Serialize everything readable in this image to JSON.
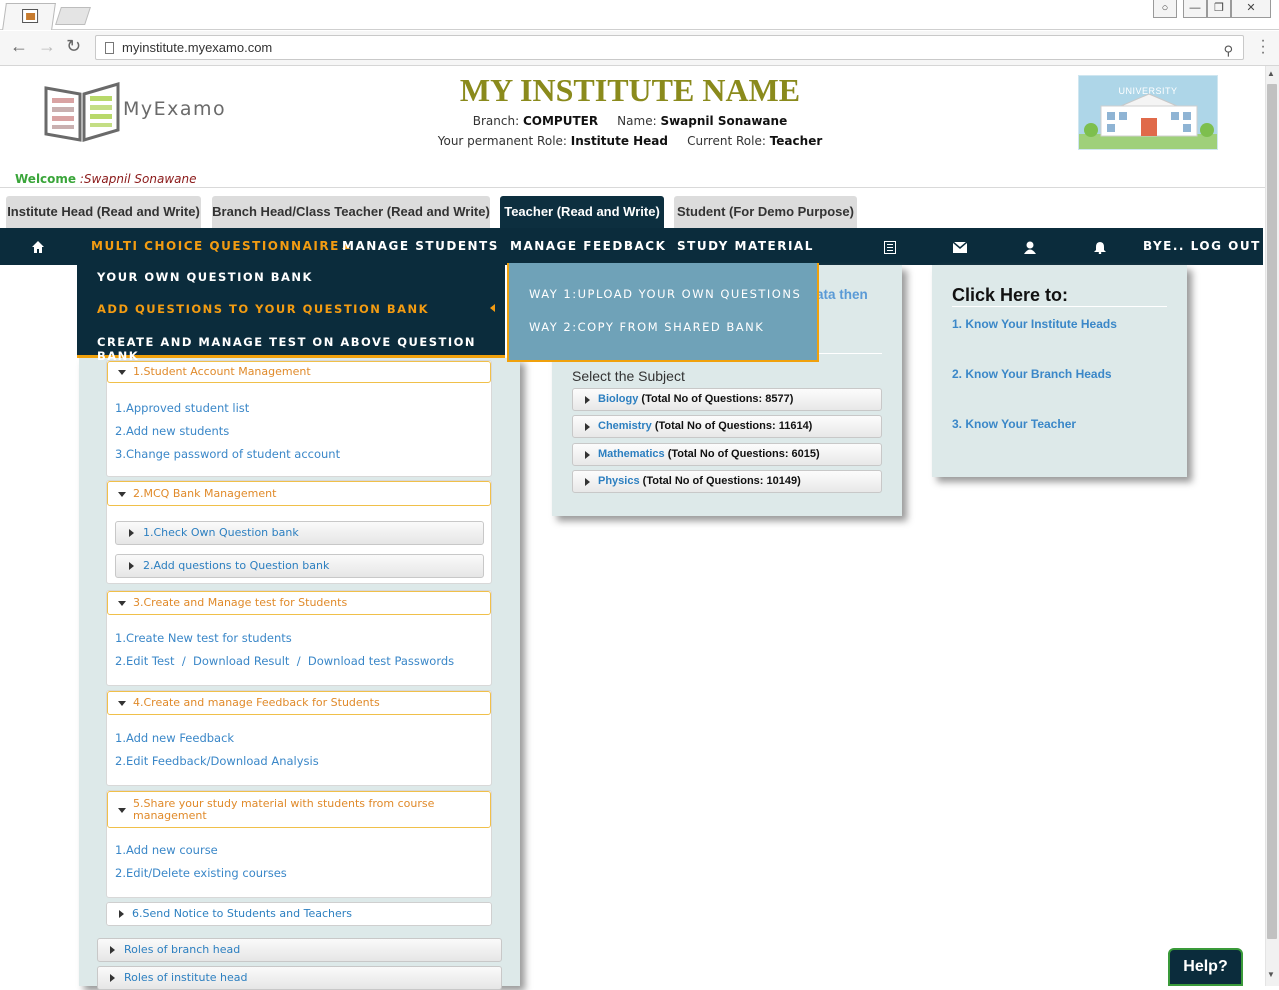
{
  "browser": {
    "url": "myinstitute.myexamo.com",
    "window_controls": [
      "—",
      "❐",
      "✕"
    ]
  },
  "header": {
    "logo_text": "MyExamo",
    "institute_name": "MY INSTITUTE NAME",
    "branch_label": "Branch:",
    "branch_value": "COMPUTER",
    "name_label": "Name:",
    "name_value": "Swapnil Sonawane",
    "perm_role_label": "Your permanent Role:",
    "perm_role_value": "Institute Head",
    "current_role_label": "Current Role:",
    "current_role_value": "Teacher",
    "university_label": "UNIVERSITY",
    "welcome_label": "Welcome",
    "welcome_name": ":Swapnil Sonawane"
  },
  "role_tabs": [
    {
      "label": "Institute Head (Read and Write)",
      "active": false
    },
    {
      "label": "Branch Head/Class Teacher (Read and Write)",
      "active": false
    },
    {
      "label": "Teacher (Read and Write)",
      "active": true
    },
    {
      "label": "Student (For Demo Purpose)",
      "active": false
    }
  ],
  "nav": {
    "items": [
      "MULTI CHOICE QUESTIONNAIRE",
      "MANAGE STUDENTS",
      "MANAGE FEEDBACK",
      "STUDY MATERIAL"
    ],
    "logout": "BYE.. LOG OUT",
    "icons": [
      "home-icon",
      "list-icon",
      "envelope-icon",
      "user-icon",
      "bell-icon"
    ]
  },
  "dropdown": {
    "items": [
      "YOUR OWN QUESTION BANK",
      "ADD QUESTIONS TO YOUR QUESTION BANK",
      "CREATE AND MANAGE TEST ON ABOVE QUESTION BANK"
    ],
    "active_index": 1,
    "submenu": [
      "WAY 1:UPLOAD YOUR OWN QUESTIONS",
      "WAY 2:COPY FROM SHARED BANK"
    ]
  },
  "left_panel": {
    "sections": [
      {
        "title": "1.Student Account Management",
        "links": [
          "1.Approved student list",
          "2.Add new students",
          "3.Change password of student account"
        ]
      },
      {
        "title": "2.MCQ Bank Management",
        "subitems": [
          "1.Check Own Question bank",
          "2.Add questions to Question bank"
        ]
      },
      {
        "title": "3.Create and Manage test for Students",
        "links": [
          "1.Create New test for students",
          "2.Edit Test  /  Download Result  /  Download test Passwords"
        ]
      },
      {
        "title": "4.Create and manage Feedback for Students",
        "links": [
          "1.Add new Feedback",
          "2.Edit Feedback/Download Analysis"
        ]
      },
      {
        "title_line1": "5.Share your study material with students from course",
        "title_line2": "management",
        "links": [
          "1.Add new course",
          "2.Edit/Delete existing courses"
        ]
      },
      {
        "title": "6.Send Notice to Students and Teachers"
      }
    ],
    "roles": [
      "Roles of branch head",
      "Roles of institute head"
    ]
  },
  "center_panel": {
    "partial_text": "ata then",
    "select_label": "Select the Subject",
    "subjects": [
      {
        "name": "Biology",
        "count": "(Total No of Questions: 8577)"
      },
      {
        "name": "Chemistry",
        "count": "(Total No of Questions: 11614)"
      },
      {
        "name": "Mathematics",
        "count": "(Total No of Questions: 6015)"
      },
      {
        "name": "Physics",
        "count": "(Total No of Questions: 10149)"
      }
    ]
  },
  "right_panel": {
    "title": "Click Here to:",
    "links": [
      "1. Know Your Institute Heads",
      "2. Know Your Branch Heads",
      "3. Know Your Teacher"
    ]
  },
  "help_label": "Help?"
}
